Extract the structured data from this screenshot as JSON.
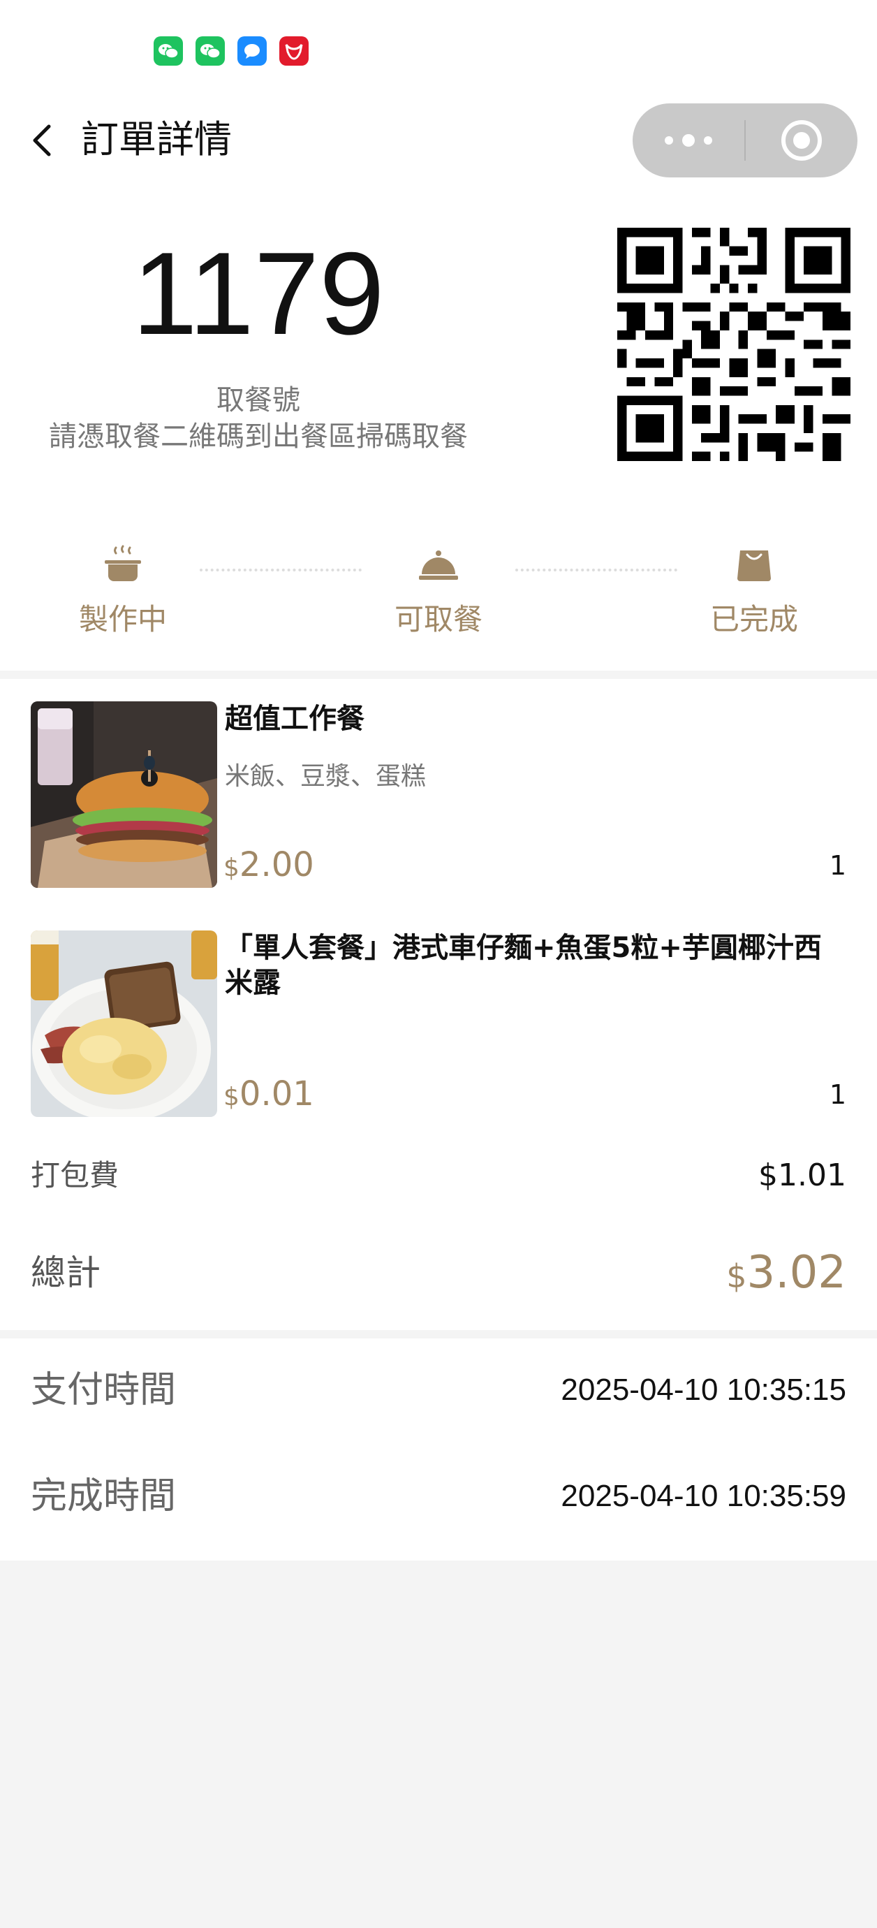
{
  "status_bar": {
    "app_icons": [
      "wechat-icon",
      "wechat-icon",
      "message-icon",
      "bull-icon"
    ]
  },
  "header": {
    "title": "訂單詳情"
  },
  "pickup": {
    "number": "1179",
    "label": "取餐號",
    "hint": "請憑取餐二維碼到出餐區掃碼取餐"
  },
  "progress": {
    "steps": [
      {
        "label": "製作中",
        "icon": "pot-icon"
      },
      {
        "label": "可取餐",
        "icon": "cloche-icon"
      },
      {
        "label": "已完成",
        "icon": "bag-icon"
      }
    ]
  },
  "items": [
    {
      "name": "超值工作餐",
      "desc": "米飯、豆漿、蛋糕",
      "currency": "$",
      "price": "2.00",
      "qty": "1",
      "image": "burger-photo"
    },
    {
      "name": "「單人套餐」港式車仔麵+魚蛋5粒+芋圓椰汁西米露",
      "desc": "",
      "currency": "$",
      "price": "0.01",
      "qty": "1",
      "image": "breakfast-photo"
    }
  ],
  "summary": {
    "packaging_label": "打包費",
    "packaging_value": "$1.01",
    "total_label": "總計",
    "total_currency": "$",
    "total_value": "3.02"
  },
  "times": {
    "paid_label": "支付時間",
    "paid_value": "2025-04-10 10:35:15",
    "done_label": "完成時間",
    "done_value": "2025-04-10 10:35:59"
  },
  "colors": {
    "accent": "#a08866",
    "background": "#f4f4f4",
    "capsule": "#c9c9c9"
  }
}
